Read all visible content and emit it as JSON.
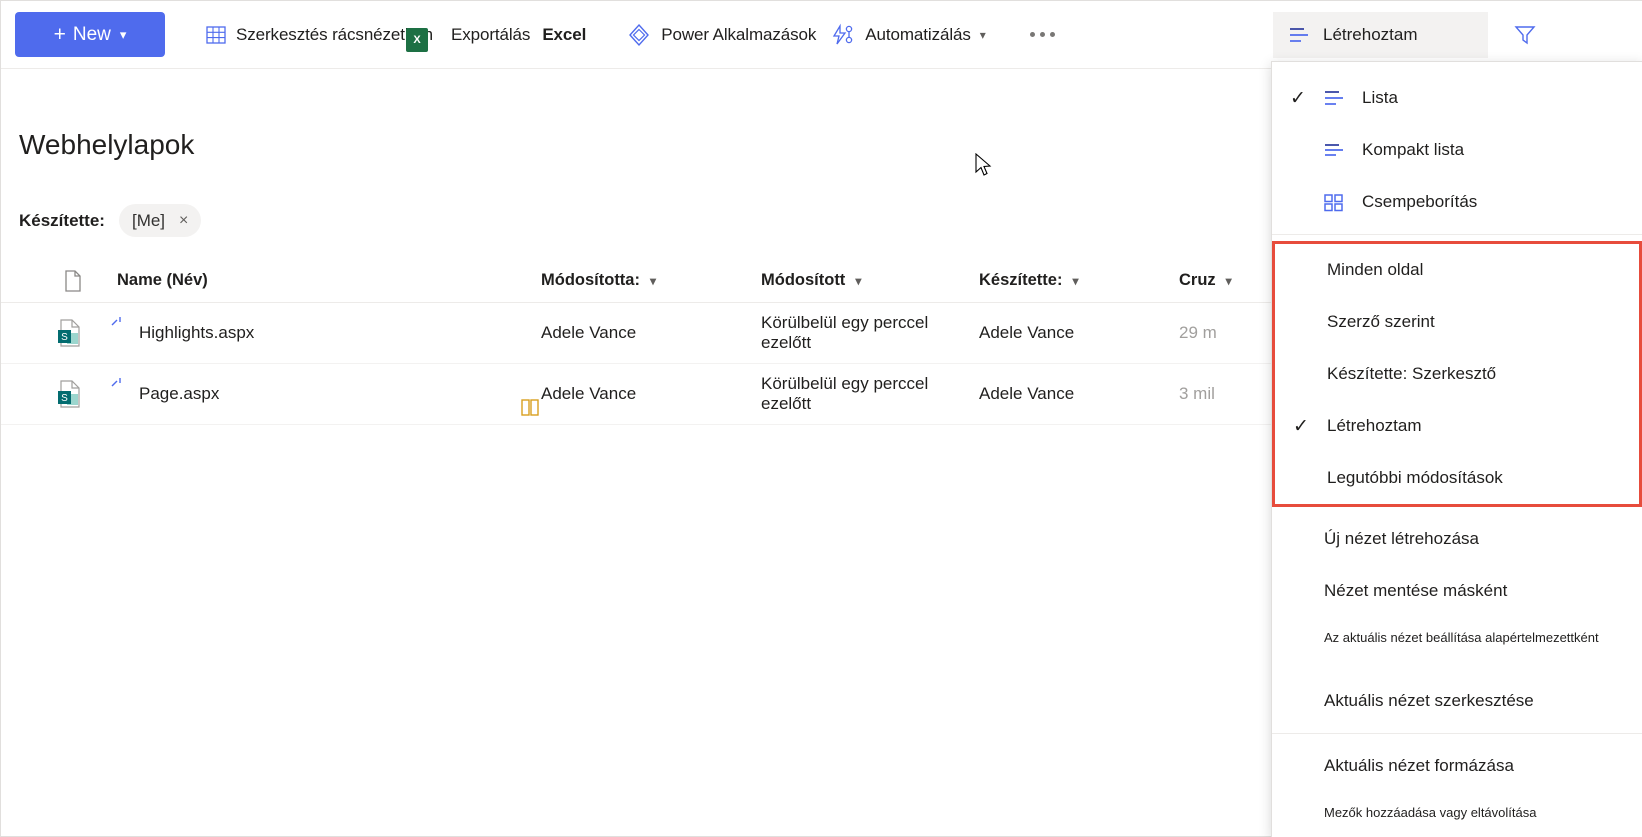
{
  "commandbar": {
    "new_button": {
      "label": "New",
      "plus": "+",
      "chevron": "⌄"
    },
    "items": [
      {
        "name": "edit-grid-view",
        "label": "Szerkesztés rácsnézetben",
        "icon": "grid-icon",
        "chevron": false
      },
      {
        "name": "export",
        "label": "Exportálás",
        "icon": "none",
        "chevron": false
      },
      {
        "name": "excel",
        "label": "Excel",
        "icon": "excel-icon",
        "chevron": false
      },
      {
        "name": "power-apps",
        "label": "Power Alkalmazások",
        "icon": "power-apps-icon",
        "chevron": false
      },
      {
        "name": "automate",
        "label": "Automatizálás",
        "icon": "power-automate-icon",
        "chevron": true
      }
    ],
    "overflow_label": "...",
    "excel_badge": "X"
  },
  "view_switcher": {
    "label": "Létrehoztam",
    "icon": "list-view-icon",
    "filter_icon": "filter-funnel-icon"
  },
  "page": {
    "title": "Webhelylapok",
    "filter_label": "Készítette:",
    "filter_pill_value": "[Me]",
    "filter_pill_remove": "×"
  },
  "table": {
    "columns": [
      {
        "key": "icon",
        "label": "",
        "icon": "file-type-icon",
        "chevron": false
      },
      {
        "key": "name",
        "label": "Name (Név)",
        "chevron": false
      },
      {
        "key": "modified_by",
        "label": "Módosította:",
        "chevron": true
      },
      {
        "key": "modified",
        "label": "Módosított",
        "chevron": true
      },
      {
        "key": "created_by",
        "label": "Készítette:",
        "chevron": true
      },
      {
        "key": "extra",
        "label": "Cruz",
        "chevron": true
      }
    ],
    "rows": [
      {
        "icon": "sharepoint-page-icon",
        "new_indicator": "sparkle-icon",
        "name": "Highlights.aspx",
        "badge": "",
        "modified_by": "Adele Vance",
        "modified": "Körülbelül egy perccel ezelőtt",
        "created_by": "Adele Vance",
        "extra": "29 m"
      },
      {
        "icon": "sharepoint-page-icon",
        "new_indicator": "sparkle-icon",
        "name": "Page.aspx",
        "badge": "news-page-icon",
        "modified_by": "Adele Vance",
        "modified": "Körülbelül egy perccel ezelőtt",
        "created_by": "Adele Vance",
        "extra": "3 mil"
      }
    ]
  },
  "dropdown": {
    "layout_options": [
      {
        "label": "Lista",
        "icon": "list-view-icon",
        "checked": true
      },
      {
        "label": "Kompakt lista",
        "icon": "compact-list-icon",
        "checked": false
      },
      {
        "label": "Csempeborítás",
        "icon": "tiles-icon",
        "checked": false
      }
    ],
    "views": [
      {
        "label": "Minden oldal",
        "checked": false
      },
      {
        "label": "Szerző szerint",
        "checked": false
      },
      {
        "label": "Készítette: Szerkesztő",
        "checked": false
      },
      {
        "label": "Létrehoztam",
        "checked": true
      },
      {
        "label": "Legutóbbi módosítások",
        "checked": false
      }
    ],
    "actions": [
      {
        "label": "Új nézet létrehozása",
        "small": false
      },
      {
        "label": "Nézet mentése másként",
        "small": false
      },
      {
        "label": "Az aktuális nézet beállítása alapértelmezettként",
        "small": true
      }
    ],
    "edit_action": {
      "label": "Aktuális nézet szerkesztése"
    },
    "format_actions": [
      {
        "label": "Aktuális nézet formázása",
        "small": false
      },
      {
        "label": "Mezők hozzáadása vagy eltávolítása",
        "small": true
      }
    ]
  },
  "colors": {
    "accent": "#4f6bed",
    "highlight_border": "#e74c3c",
    "sharepoint_teal": "#036c70",
    "excel_green": "#1d7044",
    "news_gold": "#d8a01e"
  }
}
